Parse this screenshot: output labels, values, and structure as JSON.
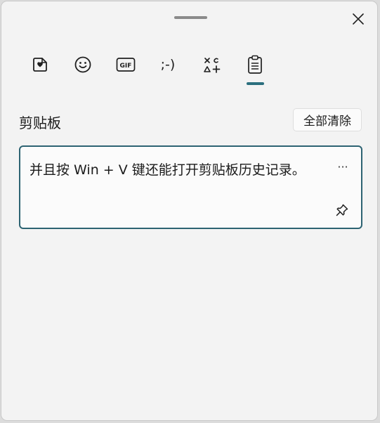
{
  "header": {
    "drag_handle_icon": "drag-handle",
    "close_icon": "close-icon"
  },
  "tabs": [
    {
      "name": "recent-stickers",
      "icon": "heart-sticker-icon"
    },
    {
      "name": "emoji",
      "icon": "smiley-icon"
    },
    {
      "name": "gif",
      "icon": "gif-icon",
      "label": "GIF"
    },
    {
      "name": "kaomoji",
      "icon": "kaomoji-icon",
      "label": ";-)"
    },
    {
      "name": "symbols",
      "icon": "symbols-icon"
    },
    {
      "name": "clipboard",
      "icon": "clipboard-icon",
      "selected": true
    }
  ],
  "colors": {
    "accent": "#2b6f7e",
    "card_border": "#2d6372",
    "panel_bg": "#f3f3f3"
  },
  "clipboard": {
    "title": "剪贴板",
    "clear_all_label": "全部清除",
    "items": [
      {
        "text": "并且按 Win + V 键还能打开剪贴板历史记录。",
        "more_label": "···",
        "pin_icon": "pin-icon"
      }
    ]
  }
}
